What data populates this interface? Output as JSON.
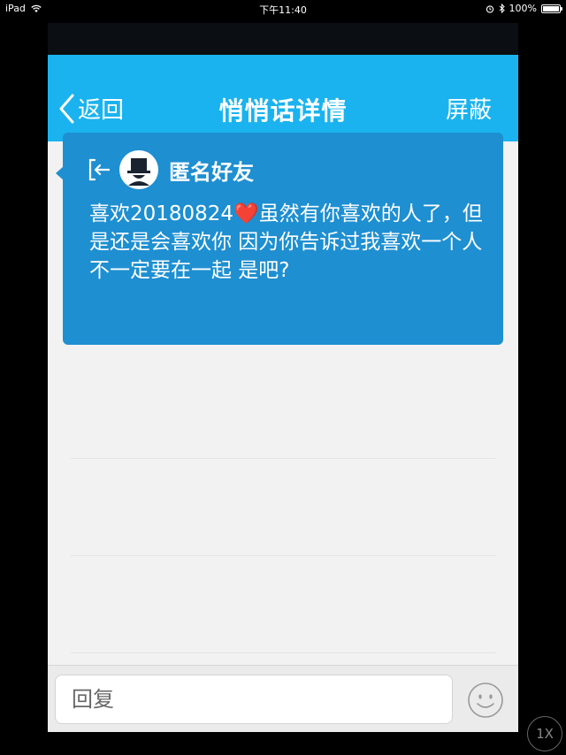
{
  "status_bar": {
    "device": "iPad",
    "time": "下午11:40",
    "battery": "100%",
    "battery_level": 1.0
  },
  "navbar": {
    "back_label": "返回",
    "title": "悄悄话详情",
    "right_action": "屏蔽",
    "color": "#1ab3ef"
  },
  "message": {
    "sender": "匿名好友",
    "text": "喜欢20180824❤️虽然有你喜欢的人了，但是还是会喜欢你 因为你告诉过我喜欢一个人不一定要在一起 是吧?",
    "card_color": "#1e8fd1"
  },
  "reply": {
    "placeholder": "回复"
  },
  "zoom_badge": "1X",
  "icons": {
    "back": "chevron-left-icon",
    "exit": "exit-arrow-icon",
    "avatar": "anonymous-avatar-icon",
    "emoji": "smiley-icon",
    "wifi": "wifi-icon",
    "alarm": "alarm-icon",
    "bluetooth": "bluetooth-icon",
    "battery": "battery-icon"
  }
}
